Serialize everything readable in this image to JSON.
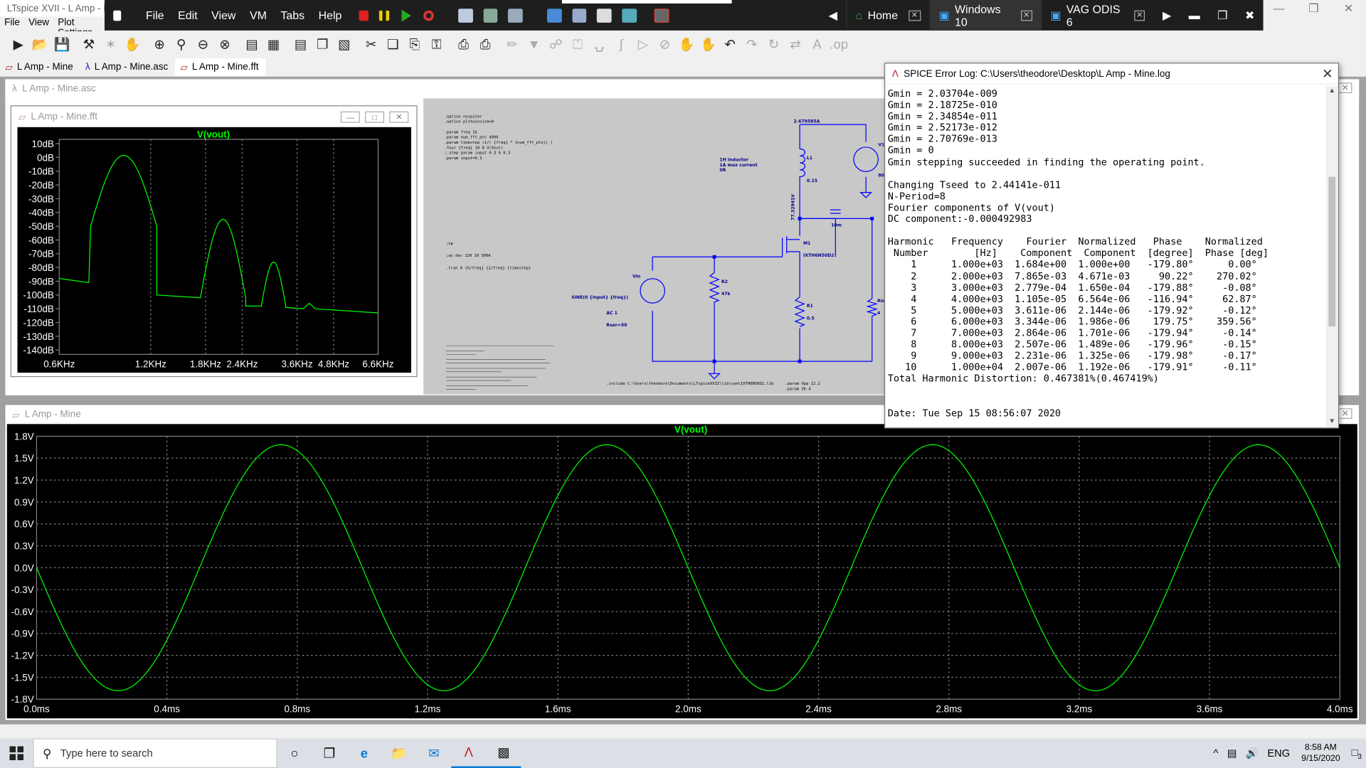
{
  "colors": {
    "trace": "#00ff00",
    "plot_bg": "#000000",
    "grid": "#808080",
    "schematic_wire": "#0000ff",
    "vm_bar": "#1e1e1e"
  },
  "titlebar": {
    "title": "LTspice XVII - L Amp - M"
  },
  "menubar": [
    "File",
    "View",
    "Plot Settings"
  ],
  "vmware": {
    "menus": [
      "File",
      "Edit",
      "View",
      "VM",
      "Tabs",
      "Help"
    ],
    "tabs": [
      {
        "label": "Home",
        "icon": "home-icon"
      },
      {
        "label": "Windows 10",
        "icon": "vm-icon"
      },
      {
        "label": "VAG ODIS 6",
        "icon": "vm-icon"
      }
    ]
  },
  "doctabs": [
    "L Amp - Mine",
    "L Amp - Mine.asc",
    "L Amp - Mine.fft"
  ],
  "windows": {
    "schematic_title": "L Amp - Mine.asc",
    "fft_title": "L Amp - Mine.fft",
    "tran_title": "L Amp - Mine"
  },
  "schematic": {
    "directives": [
      ".option nospiter",
      ".option plotwinsize=0",
      ".param freq 1k",
      ".param num_fft_pts 4096",
      ".param timestep (1/( {freq} * {num_fft_pts}) )",
      ".four {freq} 10 8 V(Vout)",
      ";.step param input 0.3 6 0.3",
      ".param input=0.3"
    ],
    "op": ";op",
    "ac": ";ac dec 120 10 500k",
    "tran": ".tran 0 {6/freq} {2/freq} {timestep}",
    "include": ".include C:\\Users\\theodore\\Documents\\LTspiceXVII\\lib\\sym\\IXTH6N50D2.lib",
    "param_vpp": ".param Vpp 12.2",
    "param_vb": ".param Vb 4",
    "labels": {
      "current": "2.679585A",
      "inductor": "1H inductor",
      "inductor_note1": "1A max current",
      "inductor_note2": "0R",
      "l1": "L1",
      "l1_val": "0.15",
      "v1": "V1",
      "v1_val": "80",
      "m1": "M1",
      "m1_part": "IXTH6N50D2",
      "vds": "77.32941V",
      "c1_val": "10m",
      "vin": "Vin",
      "sine": "SINE(0 {input} {freq})",
      "ac1": "AC 1",
      "rser": "Rser=50",
      "r2": "R2",
      "r2_val": "47k",
      "r1": "R1",
      "r1_val": "0.5",
      "rload": "Rload",
      "rload_val": "4"
    }
  },
  "fft_plot": {
    "title": "V(vout)",
    "y_ticks": [
      "10dB",
      "0dB",
      "-10dB",
      "-20dB",
      "-30dB",
      "-40dB",
      "-50dB",
      "-60dB",
      "-70dB",
      "-80dB",
      "-90dB",
      "-100dB",
      "-110dB",
      "-120dB",
      "-130dB",
      "-140dB"
    ],
    "x_ticks": [
      "0.6KHz",
      "1.2KHz",
      "1.8KHz",
      "2.4KHz",
      "3.6KHz",
      "4.8KHz",
      "6.6KHz"
    ]
  },
  "tran_plot": {
    "title": "V(vout)",
    "y_ticks": [
      "1.8V",
      "1.5V",
      "1.2V",
      "0.9V",
      "0.6V",
      "0.3V",
      "0.0V",
      "-0.3V",
      "-0.6V",
      "-0.9V",
      "-1.2V",
      "-1.5V",
      "-1.8V"
    ],
    "x_ticks": [
      "0.0ms",
      "0.4ms",
      "0.8ms",
      "1.2ms",
      "1.6ms",
      "2.0ms",
      "2.4ms",
      "2.8ms",
      "3.2ms",
      "3.6ms",
      "4.0ms"
    ]
  },
  "log": {
    "title": "SPICE Error Log: C:\\Users\\theodore\\Desktop\\L Amp - Mine.log",
    "gmin_lines": [
      "Gmin = 2.03704e-009",
      "Gmin = 2.18725e-010",
      "Gmin = 2.34854e-011",
      "Gmin = 2.52173e-012",
      "Gmin = 2.70769e-013",
      "Gmin = 0",
      "Gmin stepping succeeded in finding the operating point."
    ],
    "info_lines": [
      "Changing Tseed to 2.44141e-011",
      "N-Period=8",
      "Fourier components of V(vout)",
      "DC component:-0.000492983"
    ],
    "header1": [
      "Harmonic",
      "Frequency",
      "Fourier",
      "Normalized",
      "Phase",
      "Normalized"
    ],
    "header2": [
      "Number",
      "[Hz]",
      "Component",
      "Component",
      "[degree]",
      "Phase [deg]"
    ],
    "rows": [
      [
        "1",
        "1.000e+03",
        "1.684e+00",
        "1.000e+00",
        "-179.80°",
        "0.00°"
      ],
      [
        "2",
        "2.000e+03",
        "7.865e-03",
        "4.671e-03",
        "90.22°",
        "270.02°"
      ],
      [
        "3",
        "3.000e+03",
        "2.779e-04",
        "1.650e-04",
        "-179.88°",
        "-0.08°"
      ],
      [
        "4",
        "4.000e+03",
        "1.105e-05",
        "6.564e-06",
        "-116.94°",
        "62.87°"
      ],
      [
        "5",
        "5.000e+03",
        "3.611e-06",
        "2.144e-06",
        "-179.92°",
        "-0.12°"
      ],
      [
        "6",
        "6.000e+03",
        "3.344e-06",
        "1.986e-06",
        "179.75°",
        "359.56°"
      ],
      [
        "7",
        "7.000e+03",
        "2.864e-06",
        "1.701e-06",
        "-179.94°",
        "-0.14°"
      ],
      [
        "8",
        "8.000e+03",
        "2.507e-06",
        "1.489e-06",
        "-179.96°",
        "-0.15°"
      ],
      [
        "9",
        "9.000e+03",
        "2.231e-06",
        "1.325e-06",
        "-179.98°",
        "-0.17°"
      ],
      [
        "10",
        "1.000e+04",
        "2.007e-06",
        "1.192e-06",
        "-179.91°",
        "-0.11°"
      ]
    ],
    "thd": "Total Harmonic Distortion: 0.467381%(0.467419%)",
    "date": "Date: Tue Sep 15 08:56:07 2020"
  },
  "taskbar": {
    "search_placeholder": "Type here to search",
    "lang": "ENG",
    "time": "8:58 AM",
    "date": "9/15/2020",
    "notif_count": "3"
  }
}
